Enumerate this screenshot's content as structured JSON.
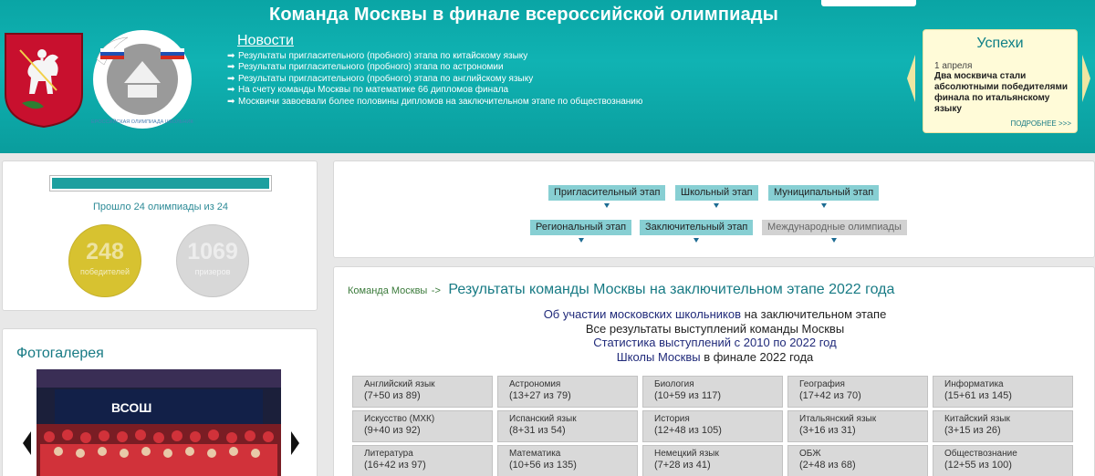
{
  "header": {
    "title": "Команда Москвы в финале всероссийской олимпиады",
    "logo_text": "ВСЕРОССИЙСКАЯ ОЛИМПИАДА ШКОЛЬНИКОВ"
  },
  "news": {
    "title": "Новости",
    "items": [
      "Результаты пригласительного (пробного) этапа по китайскому языку",
      "Результаты пригласительного (пробного) этапа по астрономии",
      "Результаты пригласительного (пробного) этапа по английскому языку",
      "На счету команды Москвы по математике 66 дипломов финала",
      "Москвичи завоевали более половины дипломов на заключительном этапе по обществознанию"
    ]
  },
  "success": {
    "title": "Успехи",
    "date": "1 апреля",
    "text": "Два москвича стали абсолютными победителями финала по итальянскому языку",
    "more": "ПОДРОБНЕЕ >>>"
  },
  "stats": {
    "progress_fraction": 1.0,
    "passed_text": "Прошло 24 олимпиады из 24",
    "winners": {
      "value": "248",
      "label": "победителей"
    },
    "prize": {
      "value": "1069",
      "label": "призеров"
    }
  },
  "gallery": {
    "title": "Фотогалерея",
    "banner": "ВСОШ"
  },
  "stages": [
    {
      "label": "Пригласительный этап",
      "enabled": true
    },
    {
      "label": "Школьный этап",
      "enabled": true
    },
    {
      "label": "Муниципальный этап",
      "enabled": true
    },
    {
      "label": "Региональный этап",
      "enabled": true
    },
    {
      "label": "Заключительный этап",
      "enabled": true
    },
    {
      "label": "Международные олимпиады",
      "enabled": false
    }
  ],
  "results": {
    "crumb_link": "Команда Москвы",
    "crumb_sep": "->",
    "title": "Результаты команды Москвы на заключительном этапе 2022 года",
    "links": [
      {
        "link": "Об участии московских школьников",
        "rest": " на заключительном этапе"
      },
      {
        "link": "",
        "rest": "Все результаты выступлений команды Москвы"
      },
      {
        "link": "Статистика выступлений с 2010 по 2022 год",
        "rest": ""
      },
      {
        "link": "Школы Москвы",
        "rest": " в финале 2022 года"
      }
    ]
  },
  "subjects": [
    {
      "name": "Английский язык",
      "count": "(7+50 из 89)"
    },
    {
      "name": "Астрономия",
      "count": "(13+27 из 79)"
    },
    {
      "name": "Биология",
      "count": "(10+59 из 117)"
    },
    {
      "name": "География",
      "count": "(17+42 из 70)"
    },
    {
      "name": "Информатика",
      "count": "(15+61 из 145)"
    },
    {
      "name": "Искусство (МХК)",
      "count": "(9+40 из 92)"
    },
    {
      "name": "Испанский язык",
      "count": "(8+31 из 54)"
    },
    {
      "name": "История",
      "count": "(12+48 из 105)"
    },
    {
      "name": "Итальянский язык",
      "count": "(3+16 из 31)"
    },
    {
      "name": "Китайский язык",
      "count": "(3+15 из 26)"
    },
    {
      "name": "Литература",
      "count": "(16+42 из 97)"
    },
    {
      "name": "Математика",
      "count": "(10+56 из 135)"
    },
    {
      "name": "Немецкий язык",
      "count": "(7+28 из 41)"
    },
    {
      "name": "ОБЖ",
      "count": "(2+48 из 68)"
    },
    {
      "name": "Обществознание",
      "count": "(12+55 из 100)"
    }
  ]
}
